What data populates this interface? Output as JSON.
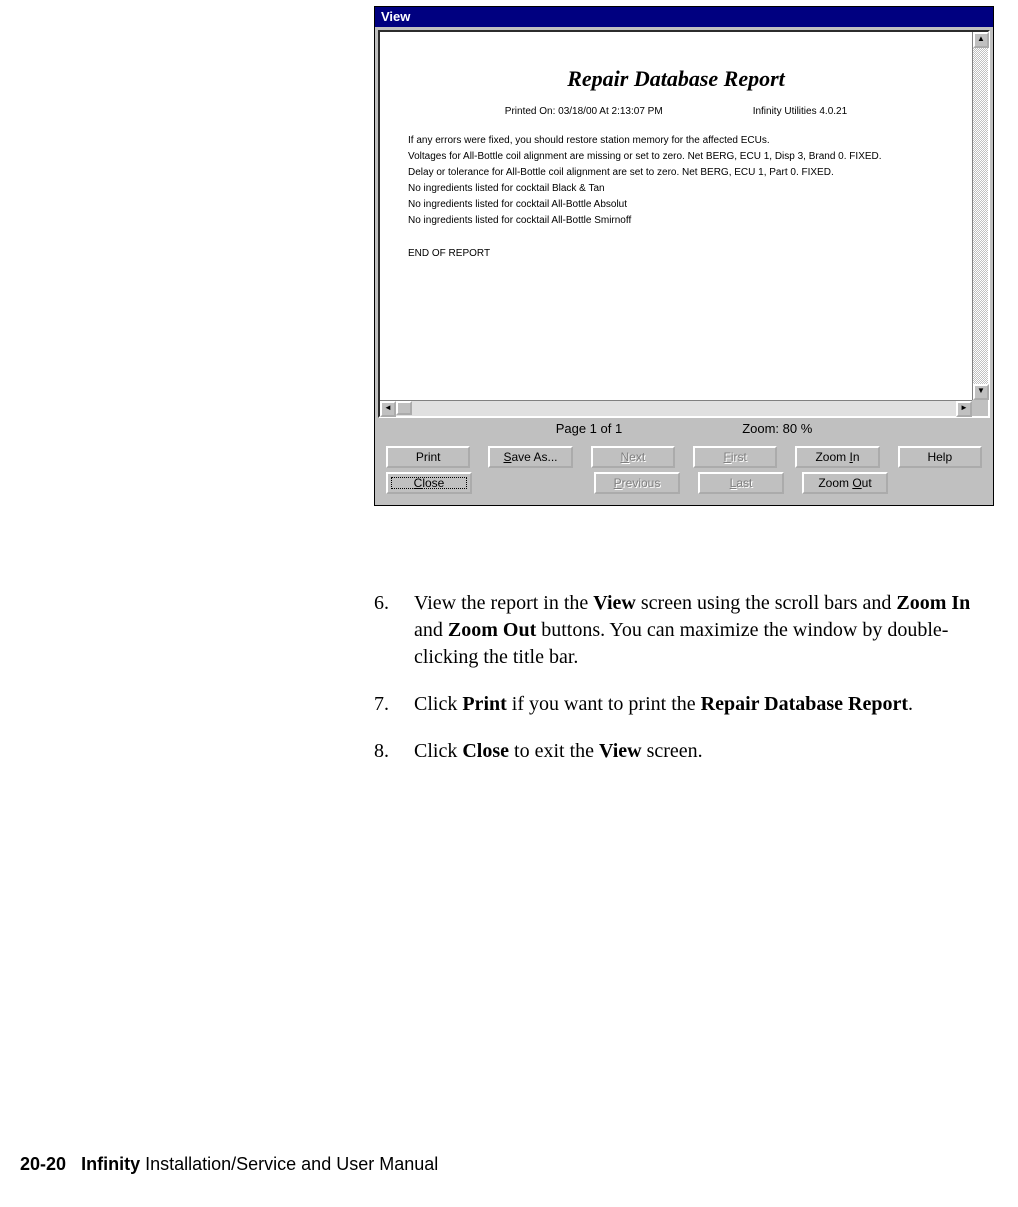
{
  "window": {
    "title": "View",
    "report": {
      "title": "Repair Database Report",
      "printed": "Printed On: 03/18/00 At 2:13:07 PM",
      "app": "Infinity Utilities 4.0.21",
      "lines": [
        "If any errors were fixed, you should restore station memory for the affected ECUs.",
        "Voltages for All-Bottle coil alignment are missing or set to zero. Net BERG, ECU 1, Disp 3, Brand 0. FIXED.",
        "Delay or tolerance for All-Bottle coil alignment are set to zero. Net BERG, ECU 1, Part 0. FIXED.",
        "No ingredients listed for cocktail Black & Tan",
        "No ingredients listed for cocktail All-Bottle Absolut",
        "No ingredients listed for cocktail All-Bottle Smirnoff"
      ],
      "end": "END OF REPORT"
    },
    "status": {
      "page": "Page 1 of 1",
      "zoom": "Zoom: 80 %"
    },
    "buttons": {
      "print": "Print",
      "saveas_pre": "S",
      "saveas_rest": "ave As...",
      "next_pre": "N",
      "next_rest": "ext",
      "first_pre": "F",
      "first_rest": "irst",
      "zoomin_pre": "Zoom ",
      "zoomin_u": "I",
      "zoomin_rest": "n",
      "help": "Help",
      "close_pre": "C",
      "close_rest": "lose",
      "previous_pre": "P",
      "previous_rest": "revious",
      "last_pre": "L",
      "last_rest": "ast",
      "zoomout_pre": "Zoom ",
      "zoomout_u": "O",
      "zoomout_rest": "ut"
    }
  },
  "instructions": {
    "step6_a": "View the report in the ",
    "step6_b1": "View",
    "step6_c": " screen using the scroll bars and ",
    "step6_b2": "Zoom In",
    "step6_d": " and ",
    "step6_b3": "Zoom Out",
    "step6_e": " buttons. You can maximize the window by double-clicking the title bar.",
    "step7_a": "Click ",
    "step7_b1": "Print",
    "step7_c": " if you want to print the ",
    "step7_b2": "Repair Database Report",
    "step7_d": ".",
    "step8_a": "Click ",
    "step8_b1": "Close",
    "step8_c": " to exit the ",
    "step8_b2": "View",
    "step8_d": " screen."
  },
  "footer": {
    "pagenum": "20-20",
    "product": "Infinity",
    "rest": " Installation/Service and User Manual"
  }
}
